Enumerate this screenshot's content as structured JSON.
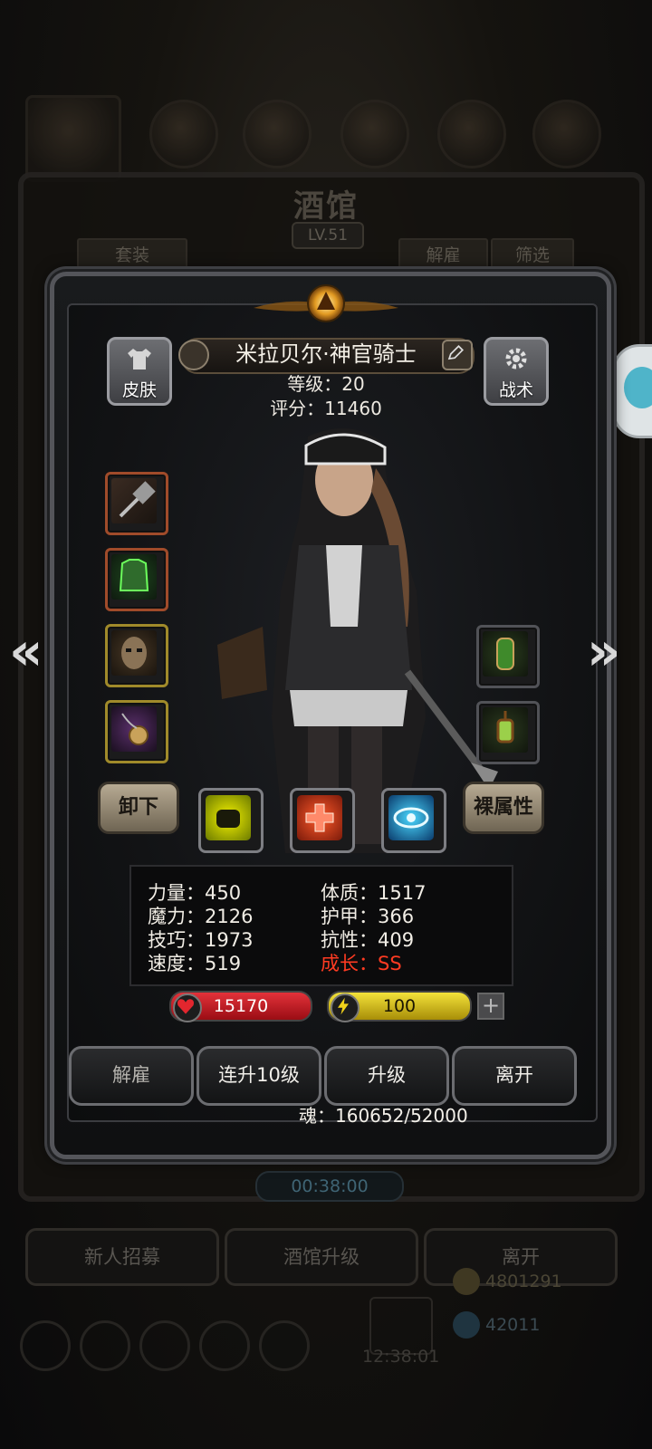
{
  "background": {
    "title": "酒馆",
    "level": "LV.51",
    "tab_left": "套装",
    "tab_dismiss": "解雇",
    "tab_filter": "筛选",
    "timer": "00:38:00",
    "bottom_buttons": [
      "新人招募",
      "酒馆升级",
      "离开"
    ],
    "gold": "4801291",
    "gems": "42011",
    "clock": "12:38:01"
  },
  "hero": {
    "name": "米拉贝尔·神官骑士",
    "level_label": "等级：20",
    "score_label": "评分：11460"
  },
  "buttons": {
    "skin": "皮肤",
    "tactics": "战术",
    "unequip": "卸下",
    "bare_stats": "裸属性"
  },
  "equipment_left": [
    "hammer-icon",
    "armor-icon",
    "mask-icon",
    "amulet-icon"
  ],
  "equipment_right": [
    "potion-icon",
    "lantern-icon"
  ],
  "skills": [
    "fist-icon",
    "heal-cross-icon",
    "eye-icon"
  ],
  "attributes": {
    "left": [
      "力量：450",
      "魔力：2126",
      "技巧：1973",
      "速度：519"
    ],
    "right": [
      "体质：1517",
      "护甲：366",
      "抗性：409"
    ],
    "growth": "成长：SS"
  },
  "bars": {
    "hp": "15170",
    "energy": "100",
    "plus": "+"
  },
  "actions": [
    "解雇",
    "连升10级",
    "升级",
    "离开"
  ],
  "soul": "魂：160652/52000",
  "colors": {
    "hp_bar": "#c4141c",
    "energy_bar": "#e2c81b",
    "growth_text": "#ff3b22"
  }
}
